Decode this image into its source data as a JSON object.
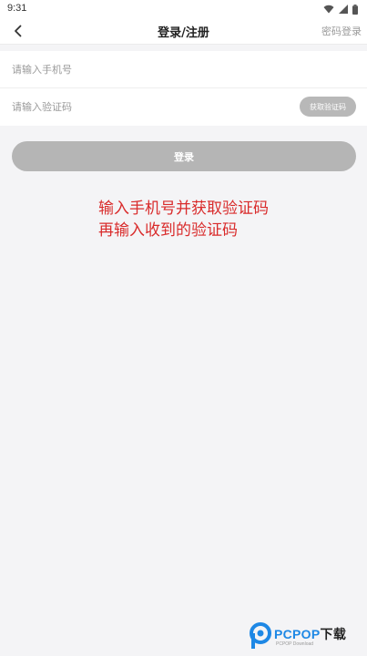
{
  "status_bar": {
    "time": "9:31",
    "icons": [
      "wifi-icon",
      "signal-icon",
      "battery-icon"
    ]
  },
  "nav": {
    "title": "登录/注册",
    "right_link": "密码登录",
    "back_icon": "chevron-left-icon"
  },
  "form": {
    "phone_placeholder": "请输入手机号",
    "phone_value": "",
    "code_placeholder": "请输入验证码",
    "code_value": "",
    "get_code_label": "获取验证码"
  },
  "login_button": {
    "label": "登录"
  },
  "annotation": {
    "line1": "输入手机号并获取验证码",
    "line2": "再输入收到的验证码"
  },
  "watermark": {
    "brand": "PCPOP",
    "brand_cn": "下载",
    "sub": "PCPOP Download"
  },
  "colors": {
    "background": "#f4f4f6",
    "disabled_button": "#b5b5b5",
    "annotation_red": "#d92b2b",
    "brand_blue": "#1e88e5"
  }
}
